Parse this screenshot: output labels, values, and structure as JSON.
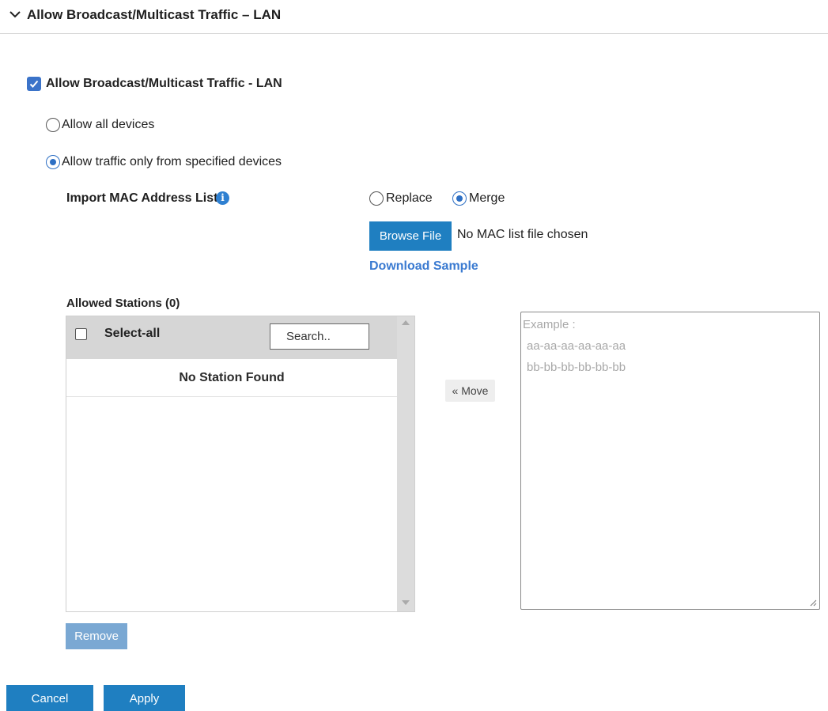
{
  "section": {
    "title": "Allow Broadcast/Multicast Traffic – LAN"
  },
  "main_checkbox": {
    "label": "Allow Broadcast/Multicast Traffic - LAN",
    "checked": true
  },
  "mode": {
    "options": [
      {
        "label": "Allow all devices",
        "selected": false
      },
      {
        "label": "Allow traffic only from specified devices",
        "selected": true
      }
    ]
  },
  "import": {
    "label": "Import MAC Address List",
    "info_icon": "info-icon",
    "options": [
      {
        "label": "Replace",
        "selected": false
      },
      {
        "label": "Merge",
        "selected": true
      }
    ],
    "browse_label": "Browse File",
    "file_status": "No MAC list file chosen",
    "download_label": "Download Sample"
  },
  "stations": {
    "title": "Allowed Stations (0)",
    "select_all_label": "Select-all",
    "search_placeholder": "Search..",
    "empty_text": "No Station Found"
  },
  "move_label": "« Move",
  "mac_input": {
    "placeholder_lines": [
      "Example :",
      "aa-aa-aa-aa-aa-aa",
      "bb-bb-bb-bb-bb-bb"
    ]
  },
  "buttons": {
    "remove": "Remove",
    "cancel": "Cancel",
    "apply": "Apply"
  },
  "colors": {
    "primary": "#1f7fc1",
    "checkbox_accent": "#3b73c9",
    "link": "#3b7bd1",
    "disabled_button": "#7aa8d3"
  }
}
